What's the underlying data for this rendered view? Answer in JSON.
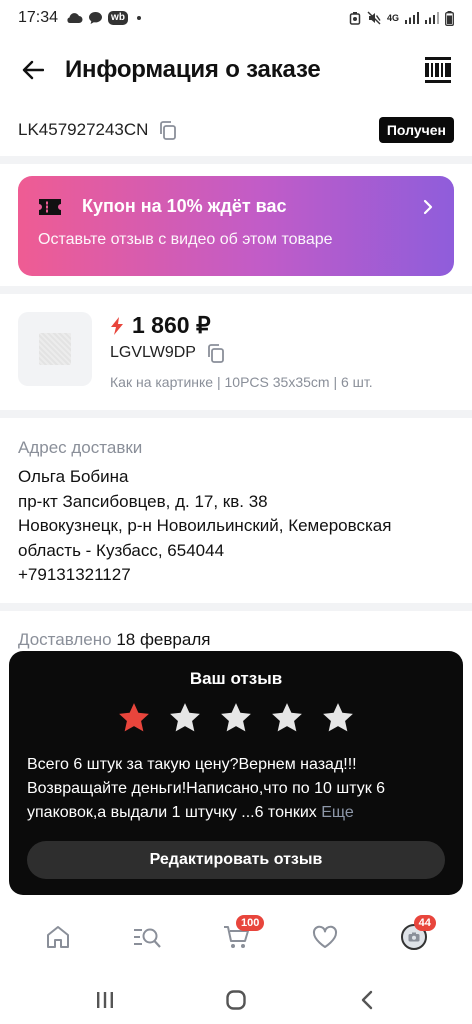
{
  "status_bar": {
    "time": "17:34",
    "wb_label": "wb",
    "net_label": "4G"
  },
  "header": {
    "title": "Информация о заказе"
  },
  "order": {
    "id": "LK457927243CN",
    "status": "Получен"
  },
  "coupon": {
    "title": "Купон на 10% ждёт вас",
    "subtitle": "Оставьте отзыв с видео об этом товаре"
  },
  "product": {
    "price": "1 860 ₽",
    "sku": "LGVLW9DP",
    "variant": "Как на картинке | 10PCS 35x35cm | 6 шт."
  },
  "address": {
    "label": "Адрес доставки",
    "name": "Ольга Бобина",
    "street": "пр-кт Запсибовцев, д. 17, кв. 38",
    "city_line1": "Новокузнецк, р-н Новоильинский, Кемеровская",
    "city_line2": "область - Кузбасс, 654044",
    "phone": "+79131321127"
  },
  "delivered": {
    "label": "Доставлено",
    "date": "18 февраля"
  },
  "review": {
    "title": "Ваш отзыв",
    "rating": 1,
    "max_rating": 5,
    "text": "Всего 6 штук за такую цену?Вернем назад!!! Возвращайте деньги!Написано,что по 10 штук 6 упаковок,а выдали 1 штучку ...6 тонких",
    "more": "Еще",
    "edit_button": "Редактировать отзыв"
  },
  "bottom_nav": {
    "cart_badge": "100",
    "profile_badge": "44"
  },
  "colors": {
    "accent_red": "#e8453c",
    "coupon_gradient_start": "#ef5c93",
    "coupon_gradient_end": "#8f5ddb",
    "muted": "#8a8f99"
  }
}
